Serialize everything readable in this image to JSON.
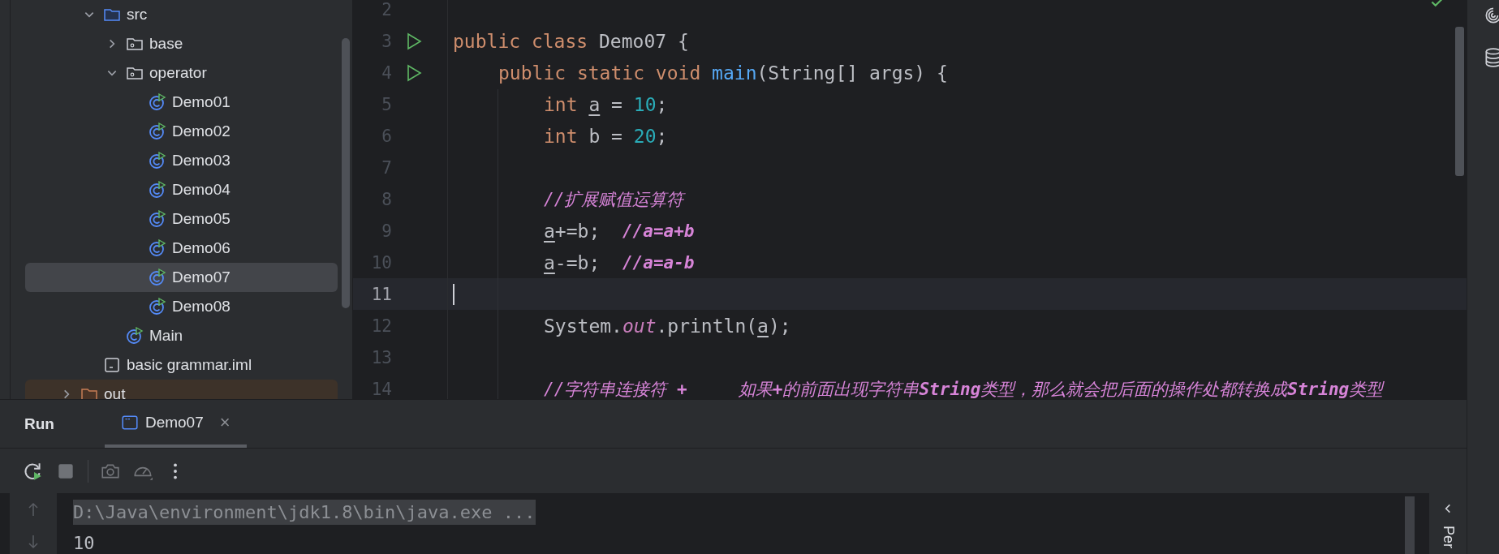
{
  "project_tree": {
    "items": [
      {
        "label": "src",
        "kind": "source-folder",
        "expanded": true,
        "selected": false,
        "children": [
          {
            "label": "base",
            "kind": "package",
            "expanded": false,
            "selected": false
          },
          {
            "label": "operator",
            "kind": "package",
            "expanded": true,
            "selected": false,
            "children": [
              {
                "label": "Demo01",
                "kind": "class",
                "selected": false
              },
              {
                "label": "Demo02",
                "kind": "class",
                "selected": false
              },
              {
                "label": "Demo03",
                "kind": "class",
                "selected": false
              },
              {
                "label": "Demo04",
                "kind": "class",
                "selected": false
              },
              {
                "label": "Demo05",
                "kind": "class",
                "selected": false
              },
              {
                "label": "Demo06",
                "kind": "class",
                "selected": false
              },
              {
                "label": "Demo07",
                "kind": "class",
                "selected": true
              },
              {
                "label": "Demo08",
                "kind": "class",
                "selected": false
              }
            ]
          },
          {
            "label": "Main",
            "kind": "class",
            "selected": false
          }
        ]
      },
      {
        "label": "basic grammar.iml",
        "kind": "module-file",
        "selected": false
      }
    ],
    "parent_sibling": {
      "label": "out",
      "kind": "excluded-folder",
      "expanded": false,
      "selected": false
    }
  },
  "editor": {
    "lines": [
      {
        "number": "2",
        "run_marker": false,
        "current": false
      },
      {
        "number": "3",
        "run_marker": true,
        "current": false,
        "tokens": [
          {
            "text": "public class ",
            "kind": "keyword"
          },
          {
            "text": "Demo07 {",
            "kind": "plain"
          }
        ],
        "children": [
          {
            "number": "4",
            "run_marker": true,
            "current": false,
            "tokens": [
              {
                "text": "public static void ",
                "kind": "keyword"
              },
              {
                "text": "main",
                "kind": "func"
              },
              {
                "text": "(String[] args) {",
                "kind": "plain"
              }
            ],
            "children": [
              {
                "number": "5",
                "run_marker": false,
                "current": false,
                "tokens": [
                  {
                    "text": "int ",
                    "kind": "keyword"
                  },
                  {
                    "text": "a",
                    "kind": "var"
                  },
                  {
                    "text": " = ",
                    "kind": "plain"
                  },
                  {
                    "text": "10",
                    "kind": "number"
                  },
                  {
                    "text": ";",
                    "kind": "plain"
                  }
                ]
              },
              {
                "number": "6",
                "run_marker": false,
                "current": false,
                "tokens": [
                  {
                    "text": "int ",
                    "kind": "keyword"
                  },
                  {
                    "text": "b = ",
                    "kind": "plain"
                  },
                  {
                    "text": "20",
                    "kind": "number"
                  },
                  {
                    "text": ";",
                    "kind": "plain"
                  }
                ]
              },
              {
                "number": "7",
                "run_marker": false,
                "current": false
              },
              {
                "number": "8",
                "run_marker": false,
                "current": false,
                "tokens": [
                  {
                    "text": "//扩展赋值运算符",
                    "kind": "comment"
                  }
                ]
              },
              {
                "number": "9",
                "run_marker": false,
                "current": false,
                "tokens": [
                  {
                    "text": "a",
                    "kind": "var"
                  },
                  {
                    "text": "+=b;  ",
                    "kind": "plain"
                  },
                  {
                    "text": "//a=a+b",
                    "kind": "bold-comment"
                  }
                ]
              },
              {
                "number": "10",
                "run_marker": false,
                "current": false,
                "tokens": [
                  {
                    "text": "a",
                    "kind": "var"
                  },
                  {
                    "text": "-=b;  ",
                    "kind": "plain"
                  },
                  {
                    "text": "//a=a-b",
                    "kind": "bold-comment"
                  }
                ]
              },
              {
                "number": "11",
                "run_marker": false,
                "current": true
              },
              {
                "number": "12",
                "run_marker": false,
                "current": false,
                "tokens": [
                  {
                    "text": "System.",
                    "kind": "plain"
                  },
                  {
                    "text": "out",
                    "kind": "field"
                  },
                  {
                    "text": ".println(",
                    "kind": "plain"
                  },
                  {
                    "text": "a",
                    "kind": "var"
                  },
                  {
                    "text": ");",
                    "kind": "plain"
                  }
                ]
              },
              {
                "number": "13",
                "run_marker": false,
                "current": false
              },
              {
                "number": "14",
                "run_marker": false,
                "current": false,
                "tokens": [
                  {
                    "text": "//字符串连接符 **+**     如果**+**的前面出现字符串**String**类型，那么就会把后面的操作处都转换成**String**类型",
                    "kind": "comment"
                  }
                ]
              }
            ]
          }
        ]
      }
    ]
  },
  "run_panel": {
    "title": "Run",
    "tabs": [
      {
        "label": "Demo07",
        "selected": true,
        "close": "×"
      }
    ],
    "toolbar": [
      {
        "kind": "rerun",
        "disabled": false
      },
      {
        "kind": "stop",
        "disabled": false
      },
      {
        "kind": "separator"
      },
      {
        "kind": "camera",
        "disabled": true
      },
      {
        "kind": "gauge",
        "disabled": true
      },
      {
        "kind": "more",
        "disabled": false
      }
    ],
    "console": [
      {
        "text": "D:\\Java\\environment\\jdk1.8\\bin\\java.exe ...",
        "kind": "command"
      },
      {
        "text": "10",
        "kind": "output"
      }
    ],
    "side_tab": "Per"
  }
}
